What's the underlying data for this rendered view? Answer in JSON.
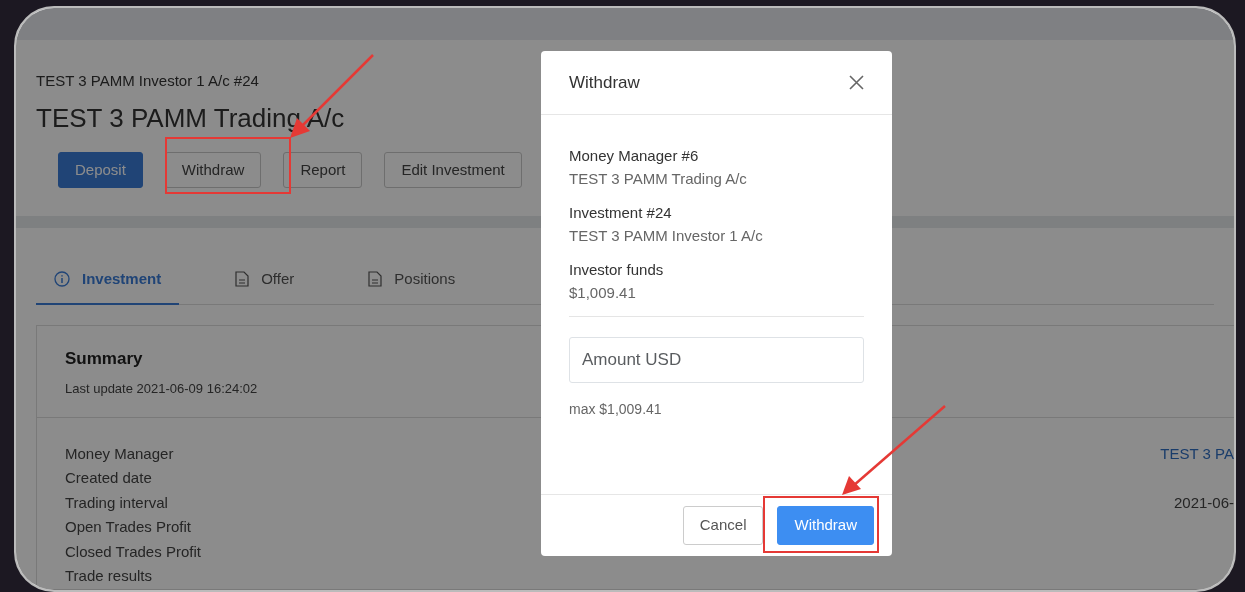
{
  "page": {
    "subtitle": "TEST 3 PAMM Investor 1 A/c #24",
    "title": "TEST 3 PAMM Trading A/c",
    "actions": [
      {
        "label": "Deposit",
        "kind": "primary"
      },
      {
        "label": "Withdraw",
        "kind": "outline"
      },
      {
        "label": "Report",
        "kind": "outline"
      },
      {
        "label": "Edit Investment",
        "kind": "outline"
      }
    ]
  },
  "tabs": [
    {
      "label": "Investment",
      "kind": "info",
      "selected": true
    },
    {
      "label": "Offer",
      "kind": "document",
      "selected": false
    },
    {
      "label": "Positions",
      "kind": "document",
      "selected": false
    }
  ],
  "summary": {
    "title": "Summary",
    "last_update": "Last update 2021-06-09 16:24:02",
    "rows": [
      {
        "label": "Money Manager",
        "value": "TEST 3 PA",
        "kind": "link"
      },
      {
        "label": "Created date"
      },
      {
        "label": "Trading interval",
        "value": "2021-06-",
        "kind": "text"
      },
      {
        "label": "Open Trades Profit"
      },
      {
        "label": "Closed Trades Profit"
      },
      {
        "label": "Trade results"
      }
    ]
  },
  "modal": {
    "title": "Withdraw",
    "fields": [
      {
        "label": "Money Manager #6",
        "value": "TEST 3 PAMM Trading A/c"
      },
      {
        "label": "Investment #24",
        "value": "TEST 3 PAMM Investor 1 A/c"
      },
      {
        "label": "Investor funds",
        "value": "$1,009.41"
      }
    ],
    "amount": {
      "placeholder": "Amount USD"
    },
    "hint": "max $1,009.41",
    "buttons": [
      {
        "label": "Cancel",
        "kind": "secondary"
      },
      {
        "label": "Withdraw",
        "kind": "primary"
      }
    ]
  }
}
